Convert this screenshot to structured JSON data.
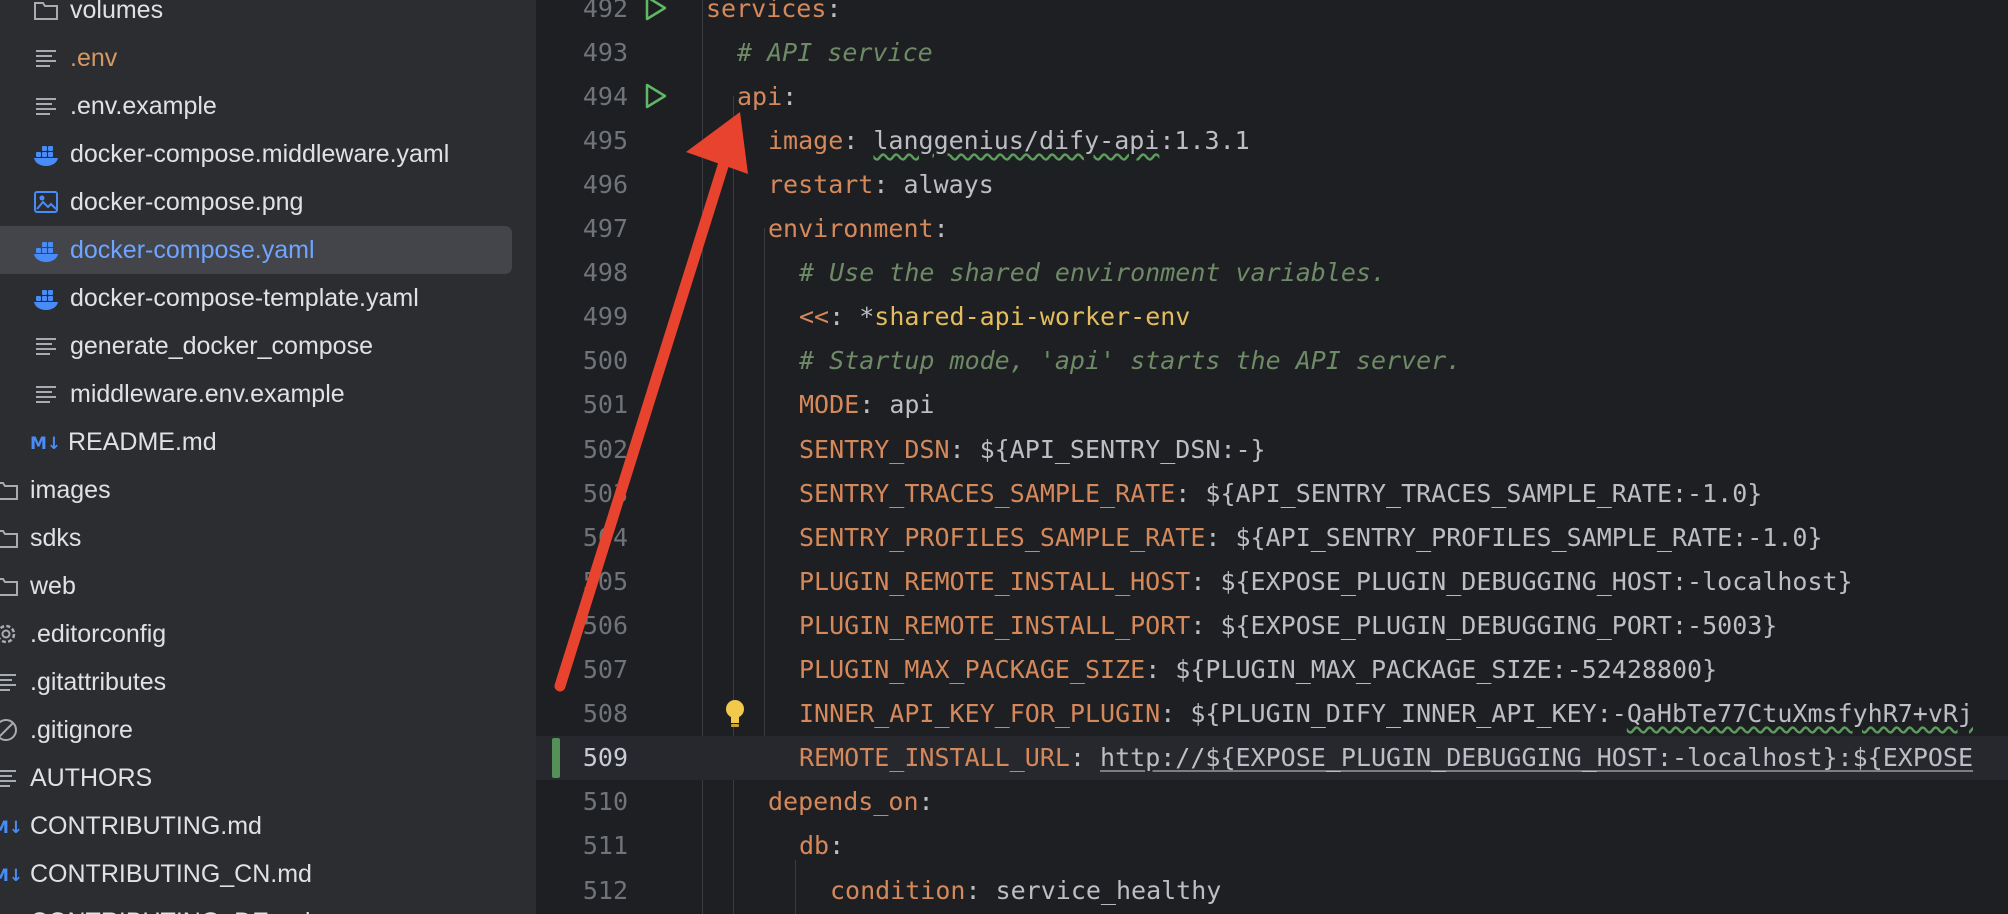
{
  "sidebar": {
    "items": [
      {
        "label": "volumes",
        "icon": "folder-icon",
        "state": "normal"
      },
      {
        "label": ".env",
        "icon": "text-file-icon",
        "state": "modified"
      },
      {
        "label": ".env.example",
        "icon": "text-file-icon",
        "state": "normal"
      },
      {
        "label": "docker-compose.middleware.yaml",
        "icon": "docker-icon",
        "state": "normal"
      },
      {
        "label": "docker-compose.png",
        "icon": "image-file-icon",
        "state": "normal"
      },
      {
        "label": "docker-compose.yaml",
        "icon": "docker-icon",
        "state": "selected"
      },
      {
        "label": "docker-compose-template.yaml",
        "icon": "docker-icon",
        "state": "normal"
      },
      {
        "label": "generate_docker_compose",
        "icon": "text-file-icon",
        "state": "normal"
      },
      {
        "label": "middleware.env.example",
        "icon": "text-file-icon",
        "state": "normal"
      },
      {
        "label": "README.md",
        "icon": "markdown-icon",
        "state": "normal"
      },
      {
        "label": "images",
        "icon": "folder-icon",
        "state": "normal"
      },
      {
        "label": "sdks",
        "icon": "folder-icon",
        "state": "normal"
      },
      {
        "label": "web",
        "icon": "folder-icon",
        "state": "normal"
      },
      {
        "label": ".editorconfig",
        "icon": "gear-icon",
        "state": "normal"
      },
      {
        "label": ".gitattributes",
        "icon": "text-file-icon",
        "state": "normal"
      },
      {
        "label": ".gitignore",
        "icon": "ignore-file-icon",
        "state": "normal"
      },
      {
        "label": "AUTHORS",
        "icon": "text-file-icon",
        "state": "normal"
      },
      {
        "label": "CONTRIBUTING.md",
        "icon": "markdown-icon",
        "state": "normal"
      },
      {
        "label": "CONTRIBUTING_CN.md",
        "icon": "markdown-icon",
        "state": "normal"
      },
      {
        "label": "CONTRIBUTING_DE.md",
        "icon": "markdown-icon",
        "state": "normal"
      }
    ]
  },
  "editor": {
    "lines": [
      {
        "num": "492",
        "tokens": [
          {
            "t": "services",
            "c": "k"
          },
          {
            "t": ":",
            "c": "v"
          }
        ],
        "indent": 0,
        "run": true
      },
      {
        "num": "493",
        "tokens": [
          {
            "t": "# API service",
            "c": "c"
          }
        ],
        "indent": 1
      },
      {
        "num": "494",
        "tokens": [
          {
            "t": "api",
            "c": "k"
          },
          {
            "t": ":",
            "c": "v"
          }
        ],
        "indent": 1,
        "run": true
      },
      {
        "num": "495",
        "tokens": [
          {
            "t": "image",
            "c": "k"
          },
          {
            "t": ": ",
            "c": "v"
          },
          {
            "t": "langgenius/dify-api",
            "c": "v squig"
          },
          {
            "t": ":1.3.1",
            "c": "v"
          }
        ],
        "indent": 2
      },
      {
        "num": "496",
        "tokens": [
          {
            "t": "restart",
            "c": "k"
          },
          {
            "t": ": always",
            "c": "v"
          }
        ],
        "indent": 2
      },
      {
        "num": "497",
        "tokens": [
          {
            "t": "environment",
            "c": "k"
          },
          {
            "t": ":",
            "c": "v"
          }
        ],
        "indent": 2
      },
      {
        "num": "498",
        "tokens": [
          {
            "t": "# Use the shared environment variables.",
            "c": "c"
          }
        ],
        "indent": 3
      },
      {
        "num": "499",
        "tokens": [
          {
            "t": "<<",
            "c": "k"
          },
          {
            "t": ": *",
            "c": "v"
          },
          {
            "t": "shared-api-worker-env",
            "c": "anchor"
          }
        ],
        "indent": 3
      },
      {
        "num": "500",
        "tokens": [
          {
            "t": "# Startup mode, 'api' starts the API server.",
            "c": "c"
          }
        ],
        "indent": 3
      },
      {
        "num": "501",
        "tokens": [
          {
            "t": "MODE",
            "c": "k"
          },
          {
            "t": ": api",
            "c": "v"
          }
        ],
        "indent": 3
      },
      {
        "num": "502",
        "tokens": [
          {
            "t": "SENTRY_DSN",
            "c": "k"
          },
          {
            "t": ": ${API_SENTRY_DSN:-}",
            "c": "v"
          }
        ],
        "indent": 3
      },
      {
        "num": "503",
        "tokens": [
          {
            "t": "SENTRY_TRACES_SAMPLE_RATE",
            "c": "k"
          },
          {
            "t": ": ${API_SENTRY_TRACES_SAMPLE_RATE:-1.0}",
            "c": "v"
          }
        ],
        "indent": 3
      },
      {
        "num": "504",
        "tokens": [
          {
            "t": "SENTRY_PROFILES_SAMPLE_RATE",
            "c": "k"
          },
          {
            "t": ": ${API_SENTRY_PROFILES_SAMPLE_RATE:-1.0}",
            "c": "v"
          }
        ],
        "indent": 3
      },
      {
        "num": "505",
        "tokens": [
          {
            "t": "PLUGIN_REMOTE_INSTALL_HOST",
            "c": "k"
          },
          {
            "t": ": ${EXPOSE_PLUGIN_DEBUGGING_HOST:-localhost}",
            "c": "v"
          }
        ],
        "indent": 3
      },
      {
        "num": "506",
        "tokens": [
          {
            "t": "PLUGIN_REMOTE_INSTALL_PORT",
            "c": "k"
          },
          {
            "t": ": ${EXPOSE_PLUGIN_DEBUGGING_PORT:-5003}",
            "c": "v"
          }
        ],
        "indent": 3
      },
      {
        "num": "507",
        "tokens": [
          {
            "t": "PLUGIN_MAX_PACKAGE_SIZE",
            "c": "k"
          },
          {
            "t": ": ${PLUGIN_MAX_PACKAGE_SIZE:-52428800}",
            "c": "v"
          }
        ],
        "indent": 3
      },
      {
        "num": "508",
        "tokens": [
          {
            "t": "INNER_API_KEY_FOR_PLUGIN",
            "c": "k"
          },
          {
            "t": ": ${PLUGIN_DIFY_INNER_API_KEY:-",
            "c": "v"
          },
          {
            "t": "QaHbTe77CtuXmsfyhR7+vRj",
            "c": "v squig"
          }
        ],
        "indent": 3,
        "bulb": true
      },
      {
        "num": "509",
        "tokens": [
          {
            "t": "REMOTE_INSTALL_URL",
            "c": "k"
          },
          {
            "t": ": ",
            "c": "v"
          },
          {
            "t": "http://${EXPOSE_PLUGIN_DEBUGGING_HOST:-localhost}:${EXPOSE",
            "c": "v u"
          }
        ],
        "indent": 3,
        "current": true,
        "changed": true
      },
      {
        "num": "510",
        "tokens": [
          {
            "t": "depends_on",
            "c": "k"
          },
          {
            "t": ":",
            "c": "v"
          }
        ],
        "indent": 2
      },
      {
        "num": "511",
        "tokens": [
          {
            "t": "db",
            "c": "k"
          },
          {
            "t": ":",
            "c": "v"
          }
        ],
        "indent": 3
      },
      {
        "num": "512",
        "tokens": [
          {
            "t": "condition",
            "c": "k"
          },
          {
            "t": ": service_healthy",
            "c": "v"
          }
        ],
        "indent": 4
      }
    ]
  },
  "colors": {
    "annotation_arrow": "#e8432e",
    "selection_bg": "#43454a",
    "yaml_key": "#d5895b",
    "comment": "#6e8a66"
  }
}
